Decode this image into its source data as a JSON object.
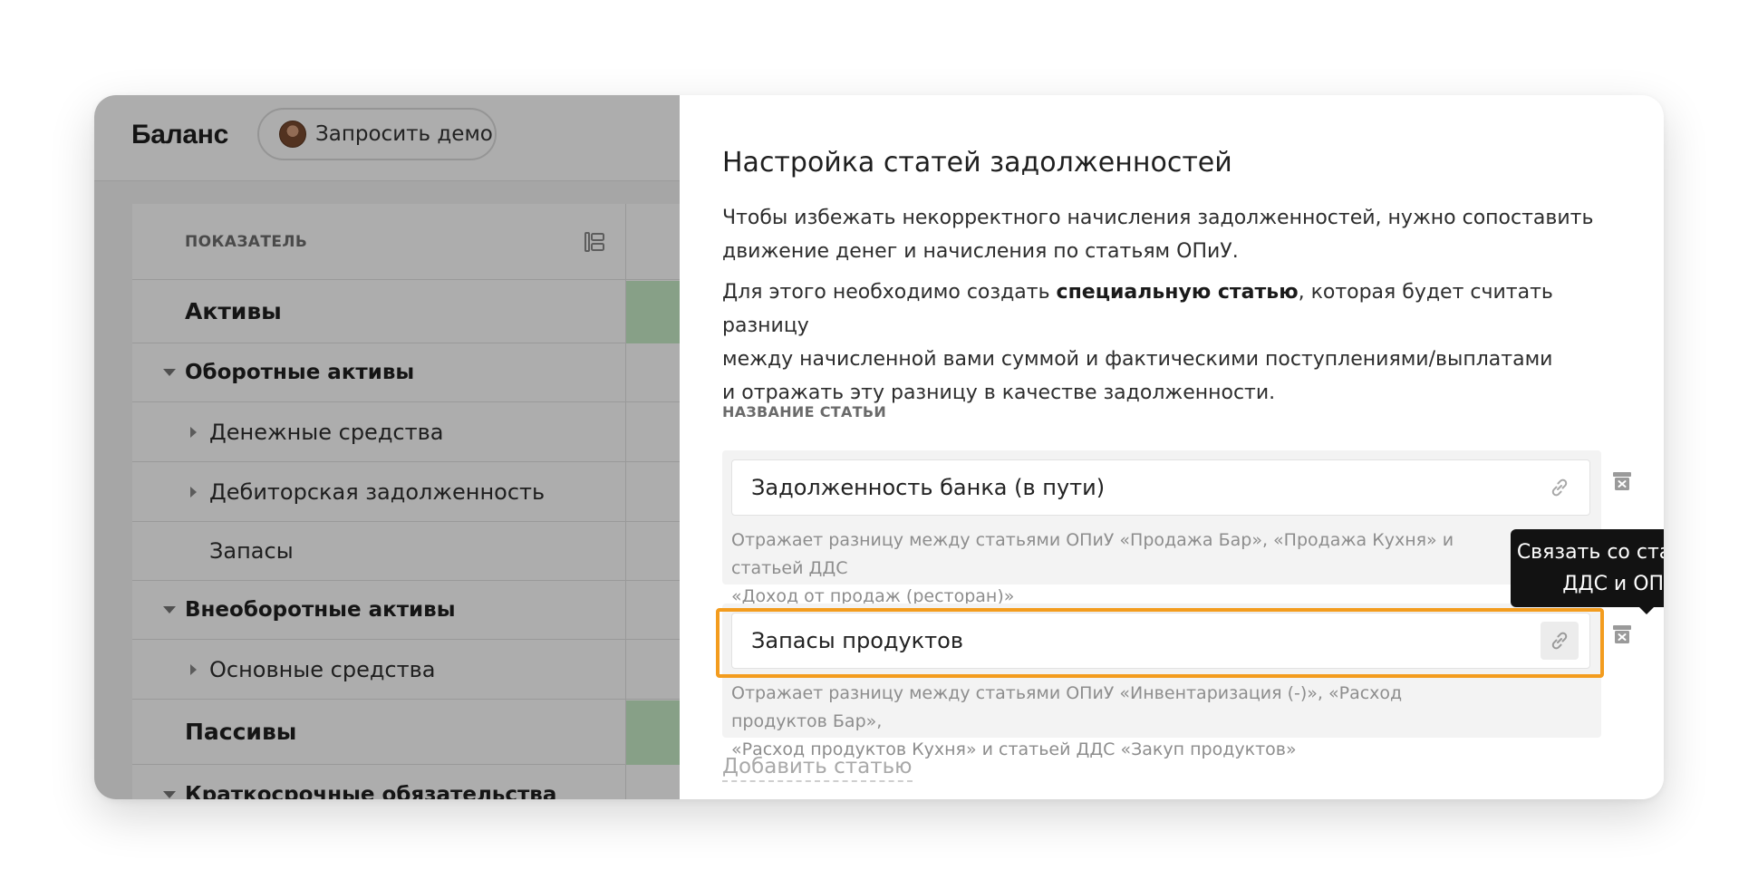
{
  "app": {
    "title": "Баланс",
    "demo_button": "Запросить демо"
  },
  "table": {
    "header": "ПОКАЗАТЕЛЬ",
    "rows": [
      {
        "label": "Активы",
        "kind": "section"
      },
      {
        "label": "Оборотные активы",
        "kind": "group"
      },
      {
        "label": "Денежные средства",
        "kind": "item"
      },
      {
        "label": "Дебиторская задолженность",
        "kind": "item"
      },
      {
        "label": "Запасы",
        "kind": "leaf"
      },
      {
        "label": "Внеоборотные активы",
        "kind": "group"
      },
      {
        "label": "Основные средства",
        "kind": "item"
      },
      {
        "label": "Пассивы",
        "kind": "section"
      },
      {
        "label": "Краткосрочные обязательства",
        "kind": "group"
      }
    ]
  },
  "drawer": {
    "title": "Настройка статей задолженностей",
    "p1_line1": "Чтобы избежать некорректного начисления задолженностей, нужно сопоставить",
    "p1_line2": "движение денег и начисления по статьям ОПиУ.",
    "p2_pre": "Для этого необходимо создать ",
    "p2_bold": "специальную статью",
    "p2_post": ", которая будет считать разницу",
    "p2_line2": "между начисленной вами суммой и фактическими поступлениями/выплатами",
    "p2_line3": "и отражать эту разницу в качестве задолженности.",
    "field_label": "НАЗВАНИЕ СТАТЬИ",
    "items": [
      {
        "name": "Задолженность банка (в пути)",
        "desc_line1": "Отражает разницу между статьями ОПиУ «Продажа Бар», «Продажа Кухня» и статьей ДДС",
        "desc_line2": "«Доход от продаж (ресторан)»"
      },
      {
        "name": "Запасы продуктов",
        "desc_line1": "Отражает разницу между статьями ОПиУ «Инвентаризация (-)», «Расход продуктов Бар»,",
        "desc_line2": "«Расход продуктов Кухня» и статьей ДДС «Закуп продуктов»"
      }
    ],
    "tooltip_line1": "Связать со статьями",
    "tooltip_line2": "ДДС и ОПиУ",
    "add_item": "Добавить статью"
  },
  "colors": {
    "highlight": "#f39c1e",
    "tooltip_bg": "#121212",
    "positive_cell": "#c7ecc8"
  },
  "icons": [
    "collapse-tree-icon",
    "caret-down-icon",
    "caret-right-icon",
    "link-icon",
    "trash-icon",
    "avatar"
  ]
}
